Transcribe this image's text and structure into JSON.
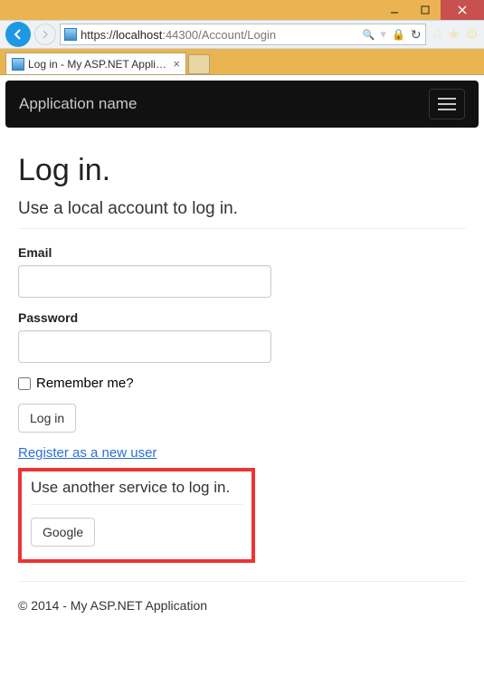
{
  "browser": {
    "url_scheme": "https://",
    "url_host": "localhost",
    "url_port": ":44300",
    "url_path": "/Account/Login",
    "search_glyph": "🔍",
    "lock_glyph": "🔒",
    "refresh_glyph": "↻",
    "home_glyph": "⌂",
    "star_glyph": "★",
    "gear_glyph": "⚙"
  },
  "tab": {
    "title": "Log in - My ASP.NET Appli…",
    "close": "×"
  },
  "app": {
    "brand": "Application name"
  },
  "page": {
    "heading": "Log in.",
    "subheading": "Use a local account to log in.",
    "email_label": "Email",
    "password_label": "Password",
    "remember_label": "Remember me?",
    "login_button": "Log in",
    "register_link": "Register as a new user",
    "external_heading": "Use another service to log in.",
    "google_button": "Google",
    "footer": "© 2014 - My ASP.NET Application"
  }
}
